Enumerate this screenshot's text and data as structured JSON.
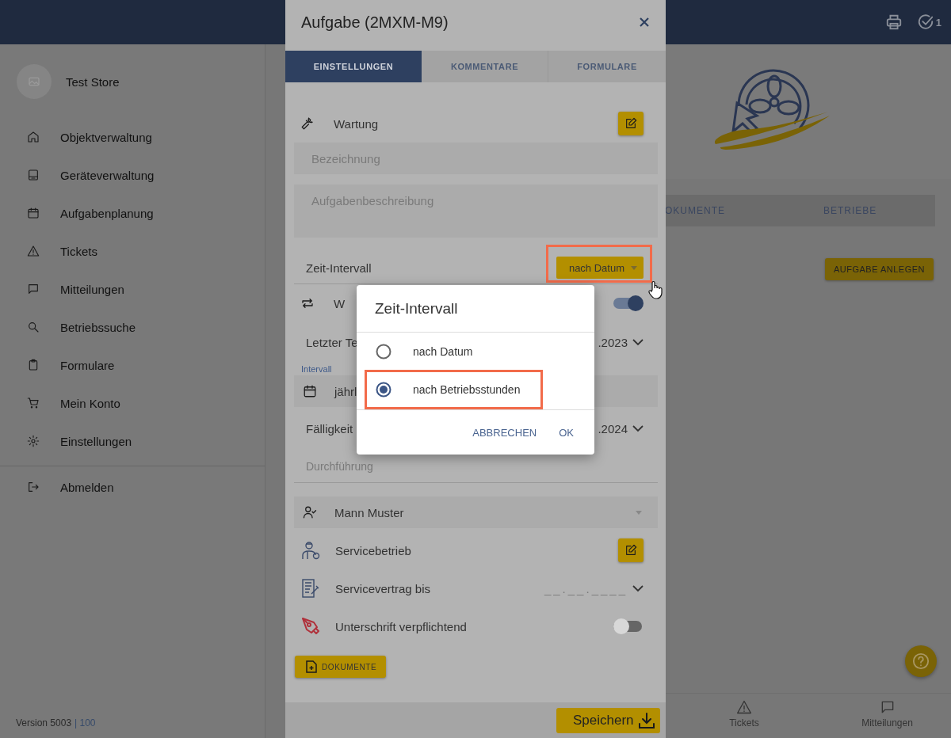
{
  "top_bar": {
    "task_count": "1"
  },
  "sidebar": {
    "store_name": "Test Store",
    "items": [
      {
        "label": "Objektverwaltung"
      },
      {
        "label": "Geräteverwaltung"
      },
      {
        "label": "Aufgabenplanung"
      },
      {
        "label": "Tickets"
      },
      {
        "label": "Mitteilungen"
      },
      {
        "label": "Betriebssuche"
      },
      {
        "label": "Formulare"
      },
      {
        "label": "Mein Konto"
      },
      {
        "label": "Einstellungen"
      }
    ],
    "logout": "Abmelden",
    "version": "Version 5003",
    "build": "| 100"
  },
  "background": {
    "tabs": [
      {
        "label": "OKUMENTE"
      },
      {
        "label": "BETRIEBE"
      }
    ],
    "create_button": "AUFGABE ANLEGEN",
    "bottom_nav": [
      {
        "label": "Tickets"
      },
      {
        "label": "Mitteilungen"
      }
    ]
  },
  "modal": {
    "title": "Aufgabe (2MXM-M9)",
    "tabs": [
      {
        "label": "EINSTELLUNGEN",
        "selected": true
      },
      {
        "label": "KOMMENTARE",
        "selected": false
      },
      {
        "label": "FORMULARE",
        "selected": false
      }
    ],
    "type": "Wartung",
    "name_placeholder": "Bezeichnung",
    "description_placeholder": "Aufgabenbeschreibung",
    "interval": {
      "label": "Zeit-Intervall",
      "value": "nach Datum",
      "highlight": true
    },
    "repeat": {
      "label": "W",
      "on": true
    },
    "last_date": {
      "label": "Letzter Te",
      "value": ".2023"
    },
    "interval_field": {
      "label": "Intervall",
      "value": "jährl"
    },
    "due": {
      "label": "Fälligkeit",
      "value": ".2024"
    },
    "execution_placeholder": "Durchführung",
    "assignee": "Mann Muster",
    "service_company": "Servicebetrieb",
    "contract": {
      "label": "Servicevertrag bis",
      "placeholder": "__.__.____"
    },
    "signature": {
      "label": "Unterschrift verpflichtend",
      "on": false
    },
    "documents_button": "DOKUMENTE",
    "save_button": "Speichern"
  },
  "dialog": {
    "title": "Zeit-Intervall",
    "options": [
      {
        "label": "nach Datum",
        "selected": false,
        "highlight": false
      },
      {
        "label": "nach Betriebsstunden",
        "selected": true,
        "highlight": true
      }
    ],
    "buttons": [
      "ABBRECHEN",
      "OK"
    ]
  }
}
